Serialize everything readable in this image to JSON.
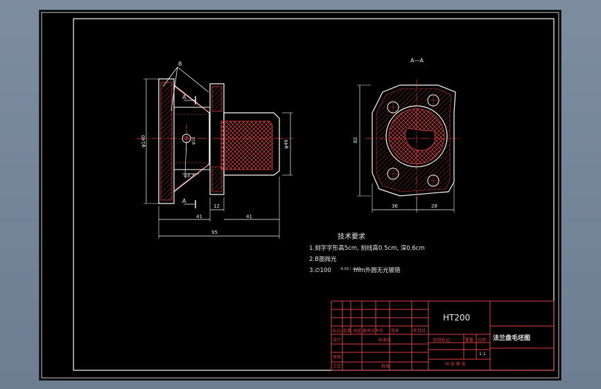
{
  "section_label": "A—A",
  "section_mark_top": "A",
  "section_mark_bottom": "A",
  "surface_mark": "B",
  "dims": {
    "dia_outer": "φ140",
    "dia_mid": "φ16",
    "dia_right": "φ46",
    "hole": "φ3.3",
    "d41_left": "41",
    "d41_right": "41",
    "d12": "12",
    "d95": "95",
    "d82": "82",
    "d36": "36",
    "d28": "28"
  },
  "tech": {
    "title": "技术要求",
    "line1": "1.刻字字形高5cm, 刻线高0.5cm, 深0.6cm",
    "line2": "2.B面抛光",
    "line3_a": "3.∅100",
    "line3_tol": "-0.03 / -0.05",
    "line3_b": "mm外圆无光镀铬"
  },
  "title_block": {
    "material": "HT200",
    "drawing_name": "法兰盘毛坯图",
    "row_labels": [
      "标记",
      "处数",
      "分区",
      "更改文件号",
      "签名",
      "年月日"
    ],
    "design": "设计",
    "standard": "标准化",
    "review": "审核",
    "process": "工艺",
    "approve": "批准",
    "stage": "阶段标记",
    "weight": "重量",
    "scale": "比例",
    "scale_value": "1:1",
    "sheet": "共 张 第 张"
  }
}
